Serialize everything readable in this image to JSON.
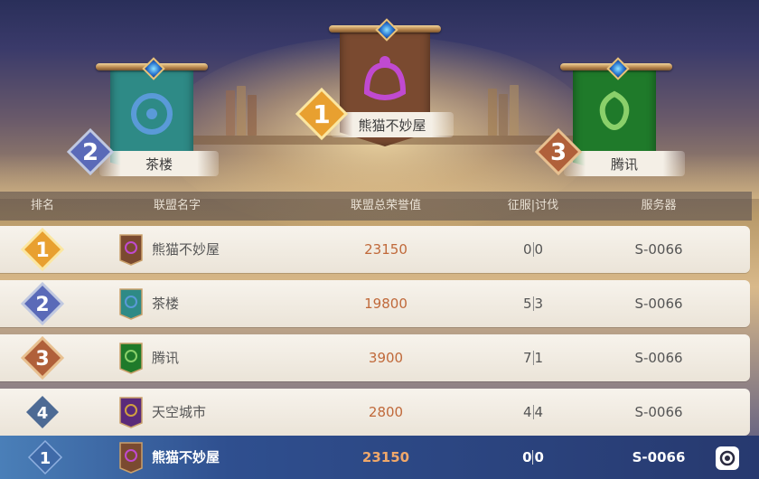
{
  "podium": [
    {
      "rank": "2",
      "name": "茶楼",
      "flag_color": "#2e8a86",
      "emblem_color": "#5a9ad8"
    },
    {
      "rank": "1",
      "name": "熊猫不妙屋",
      "flag_color": "#7a4a30",
      "emblem_color": "#c04ad0"
    },
    {
      "rank": "3",
      "name": "腾讯",
      "flag_color": "#1f7a2a",
      "emblem_color": "#8ad06a"
    }
  ],
  "table": {
    "headers": {
      "rank": "排名",
      "name": "联盟名字",
      "honor": "联盟总荣誉值",
      "conquer": "征服|讨伐",
      "server": "服务器"
    },
    "rows": [
      {
        "rank": "1",
        "name": "熊猫不妙屋",
        "honor": "23150",
        "conquer_a": "0",
        "conquer_b": "0",
        "server": "S-0066",
        "flag_color": "#7a4a30",
        "emblem_color": "#c04ad0"
      },
      {
        "rank": "2",
        "name": "茶楼",
        "honor": "19800",
        "conquer_a": "5",
        "conquer_b": "3",
        "server": "S-0066",
        "flag_color": "#2e8a86",
        "emblem_color": "#5a9ad8"
      },
      {
        "rank": "3",
        "name": "腾讯",
        "honor": "3900",
        "conquer_a": "7",
        "conquer_b": "1",
        "server": "S-0066",
        "flag_color": "#1f7a2a",
        "emblem_color": "#8ad06a"
      },
      {
        "rank": "4",
        "name": "天空城市",
        "honor": "2800",
        "conquer_a": "4",
        "conquer_b": "4",
        "server": "S-0066",
        "flag_color": "#5a2a7a",
        "emblem_color": "#d0a040"
      }
    ]
  },
  "self_row": {
    "rank": "1",
    "name": "熊猫不妙屋",
    "honor": "23150",
    "conquer_a": "0",
    "conquer_b": "0",
    "server": "S-0066",
    "flag_color": "#7a4a30",
    "emblem_color": "#c04ad0"
  },
  "icons": {
    "settings": "settings-icon"
  }
}
